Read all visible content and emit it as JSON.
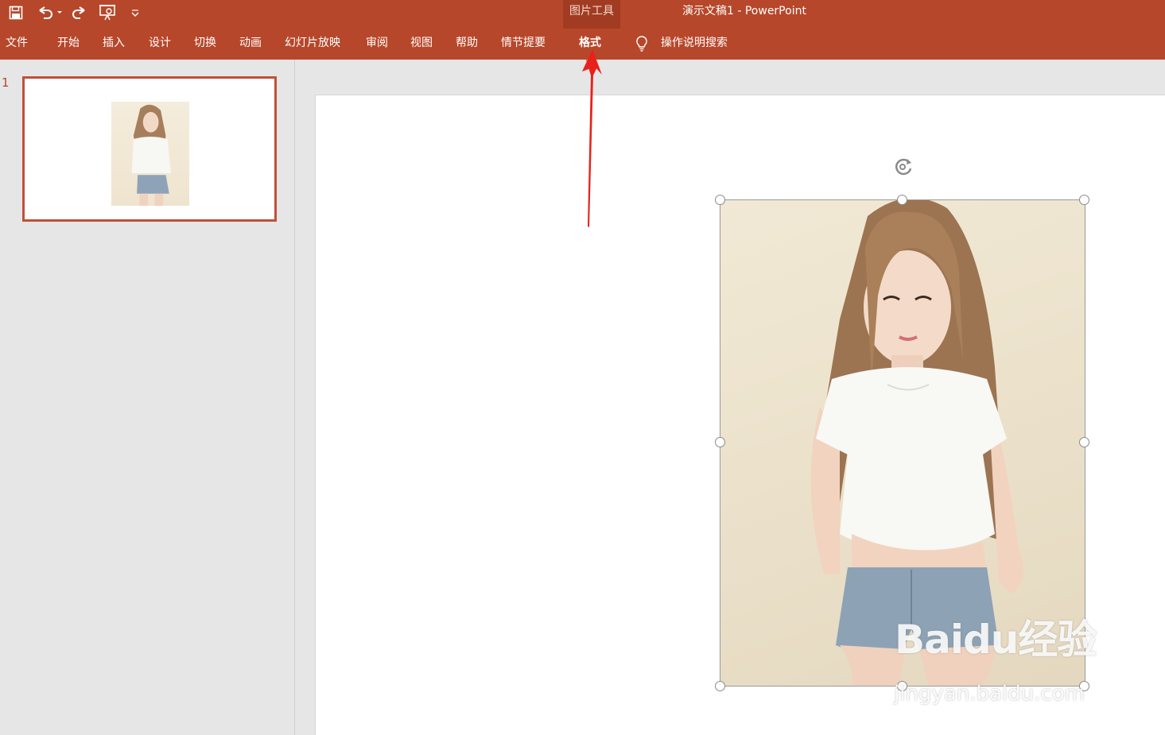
{
  "titlebar": {
    "context_group": "图片工具",
    "document_title": "演示文稿1  -  PowerPoint"
  },
  "quick_access": [
    {
      "name": "save",
      "icon": "save-icon"
    },
    {
      "name": "undo",
      "icon": "undo-icon"
    },
    {
      "name": "redo",
      "icon": "redo-icon"
    },
    {
      "name": "start-from-beginning",
      "icon": "slideshow-icon"
    },
    {
      "name": "customize",
      "icon": "chevron-down-icon"
    }
  ],
  "ribbon_tabs": [
    "文件",
    "开始",
    "插入",
    "设计",
    "切换",
    "动画",
    "幻灯片放映",
    "审阅",
    "视图",
    "帮助",
    "情节提要",
    "格式"
  ],
  "active_tab": "格式",
  "tell_me": {
    "label": "操作说明搜索",
    "icon": "lightbulb-icon"
  },
  "thumbnails": [
    {
      "number": "1",
      "selected": true
    }
  ],
  "watermark": {
    "logo": "Baidu经验",
    "url": "jingyan.baidu.com"
  },
  "colors": {
    "ribbon": "#b7472a",
    "context_tab": "#a13c22",
    "thumb_border": "#c0503a",
    "annotation_arrow": "#e8211b"
  }
}
